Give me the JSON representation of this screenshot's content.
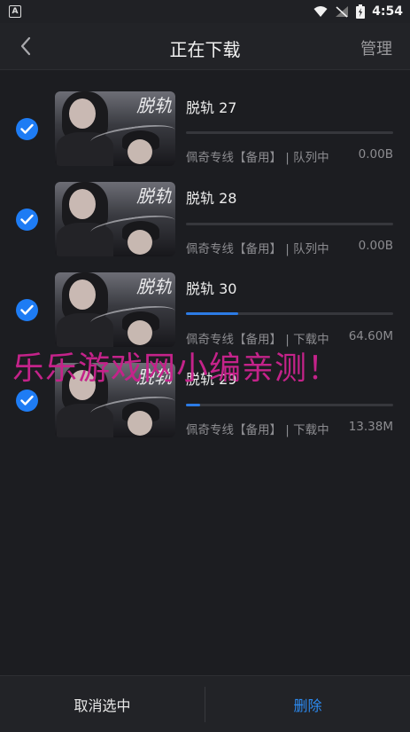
{
  "status_bar": {
    "time": "4:54"
  },
  "header": {
    "title": "正在下载",
    "manage_label": "管理"
  },
  "downloads": [
    {
      "title": "脱轨 27",
      "source": "佩奇专线【备用】",
      "state": "| 队列中",
      "size": "0.00B",
      "progress": 0.0,
      "selected": true
    },
    {
      "title": "脱轨 28",
      "source": "佩奇专线【备用】",
      "state": "| 队列中",
      "size": "0.00B",
      "progress": 0.0,
      "selected": true
    },
    {
      "title": "脱轨 30",
      "source": "佩奇专线【备用】",
      "state": "| 下载中",
      "size": "64.60M",
      "progress": 0.25,
      "selected": true
    },
    {
      "title": "脱轨 29",
      "source": "佩奇专线【备用】",
      "state": "| 下载中",
      "size": "13.38M",
      "progress": 0.07,
      "selected": true
    }
  ],
  "thumbnail_calligraphy": "脱轨",
  "watermark": "乐乐游戏网小编亲测！",
  "footer": {
    "cancel_label": "取消选中",
    "delete_label": "删除"
  },
  "colors": {
    "accent": "#1e7cf4",
    "delete": "#2c8bf2",
    "watermark": "#c4238a",
    "background": "#1c1d21"
  }
}
